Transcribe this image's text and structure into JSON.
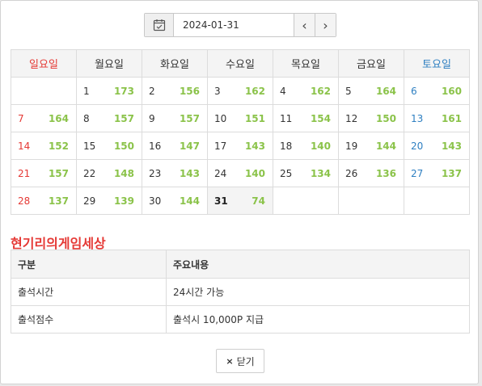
{
  "date_picker": {
    "value": "2024-01-31",
    "prev_label": "‹",
    "next_label": "›"
  },
  "weekdays": [
    "일요일",
    "월요일",
    "화요일",
    "수요일",
    "목요일",
    "금요일",
    "토요일"
  ],
  "calendar": [
    [
      null,
      {
        "day": "1",
        "count": "173"
      },
      {
        "day": "2",
        "count": "156"
      },
      {
        "day": "3",
        "count": "162"
      },
      {
        "day": "4",
        "count": "162"
      },
      {
        "day": "5",
        "count": "164"
      },
      {
        "day": "6",
        "count": "160"
      }
    ],
    [
      {
        "day": "7",
        "count": "164"
      },
      {
        "day": "8",
        "count": "157"
      },
      {
        "day": "9",
        "count": "157"
      },
      {
        "day": "10",
        "count": "151"
      },
      {
        "day": "11",
        "count": "154"
      },
      {
        "day": "12",
        "count": "150"
      },
      {
        "day": "13",
        "count": "161"
      }
    ],
    [
      {
        "day": "14",
        "count": "152"
      },
      {
        "day": "15",
        "count": "150"
      },
      {
        "day": "16",
        "count": "147"
      },
      {
        "day": "17",
        "count": "143"
      },
      {
        "day": "18",
        "count": "140"
      },
      {
        "day": "19",
        "count": "144"
      },
      {
        "day": "20",
        "count": "143"
      }
    ],
    [
      {
        "day": "21",
        "count": "157"
      },
      {
        "day": "22",
        "count": "148"
      },
      {
        "day": "23",
        "count": "143"
      },
      {
        "day": "24",
        "count": "140"
      },
      {
        "day": "25",
        "count": "134"
      },
      {
        "day": "26",
        "count": "136"
      },
      {
        "day": "27",
        "count": "137"
      }
    ],
    [
      {
        "day": "28",
        "count": "137"
      },
      {
        "day": "29",
        "count": "139"
      },
      {
        "day": "30",
        "count": "144"
      },
      {
        "day": "31",
        "count": "74",
        "today": true
      },
      null,
      null,
      null
    ]
  ],
  "section_title": "현기리의게임세상",
  "info_table": {
    "headers": [
      "구분",
      "주요내용"
    ],
    "rows": [
      [
        "출석시간",
        "24시간 가능"
      ],
      [
        "출석점수",
        "출석시 10,000P 지급"
      ]
    ]
  },
  "close_button": {
    "icon": "×",
    "label": "닫기"
  },
  "colors": {
    "sunday": "#e53935",
    "saturday": "#2e7fc1",
    "count": "#8bc34a"
  }
}
